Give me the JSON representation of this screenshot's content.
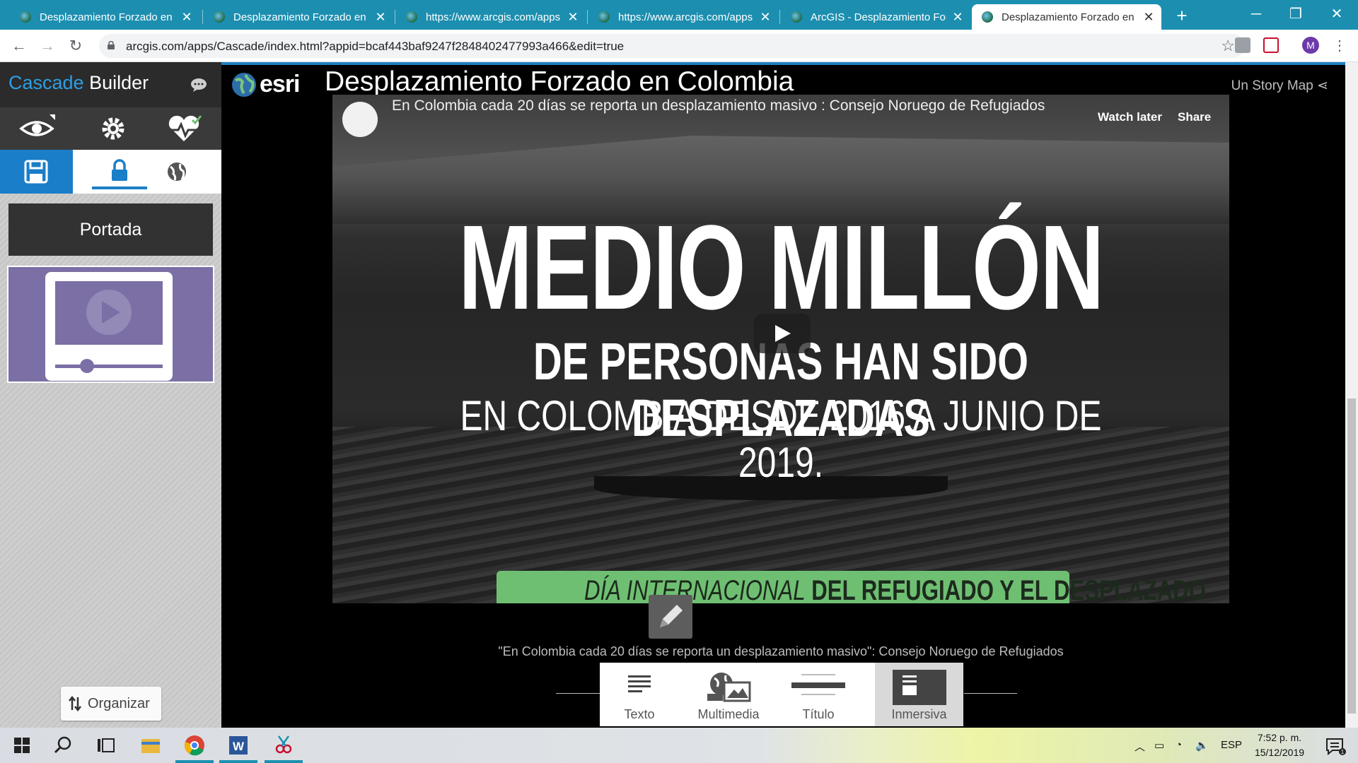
{
  "browser": {
    "tabs": [
      {
        "title": "Desplazamiento Forzado en C",
        "active": false
      },
      {
        "title": "Desplazamiento Forzado en C",
        "active": false
      },
      {
        "title": "https://www.arcgis.com/apps",
        "active": false
      },
      {
        "title": "https://www.arcgis.com/apps",
        "active": false
      },
      {
        "title": "ArcGIS - Desplazamiento For",
        "active": false
      },
      {
        "title": "Desplazamiento Forzado en C",
        "active": true
      }
    ],
    "new_tab": "+",
    "url": "arcgis.com/apps/Cascade/index.html?appid=bcaf443baf9247f2848402477993a466&edit=true",
    "profile_initial": "M"
  },
  "builder": {
    "brand_accent": "Cascade",
    "brand_rest": " Builder",
    "section_label": "Portada",
    "organize_label": "Organizar"
  },
  "story": {
    "logo_text": "esri",
    "title": "Desplazamiento Forzado en Colombia",
    "tagline": "Un Story Map",
    "video": {
      "title": "En Colombia cada 20 días se reporta un desplazamiento masivo : Consejo Noruego de Refugiados",
      "watch_later": "Watch later",
      "share": "Share",
      "headline_1": "MEDIO MILLÓN",
      "headline_2": "DE PERSONAS HAN SIDO DESPLAZADAS",
      "headline_3": "EN COLOMBIA DESDE 2016 A JUNIO DE 2019.",
      "band_italic": "DÍA INTERNACIONAL",
      "band_bold": " DEL REFUGIADO Y EL DESPLAZADO"
    },
    "caption": "\"En Colombia cada 20 días se reporta un desplazamiento masivo\": Consejo Noruego de Refugiados",
    "add_block": [
      {
        "label": "Texto",
        "icon": "text-icon"
      },
      {
        "label": "Multimedia",
        "icon": "multimedia-icon"
      },
      {
        "label": "Título",
        "icon": "title-icon"
      },
      {
        "label": "Inmersiva",
        "icon": "immersive-icon",
        "selected": true
      }
    ]
  },
  "taskbar": {
    "language": "ESP",
    "time": "7:52 p. m.",
    "date": "15/12/2019"
  },
  "colors": {
    "tab_strip": "#1c8fb0",
    "cascade_blue": "#2e9ee3",
    "save_blue": "#1b7ec8",
    "band_green": "#6fbf73"
  }
}
